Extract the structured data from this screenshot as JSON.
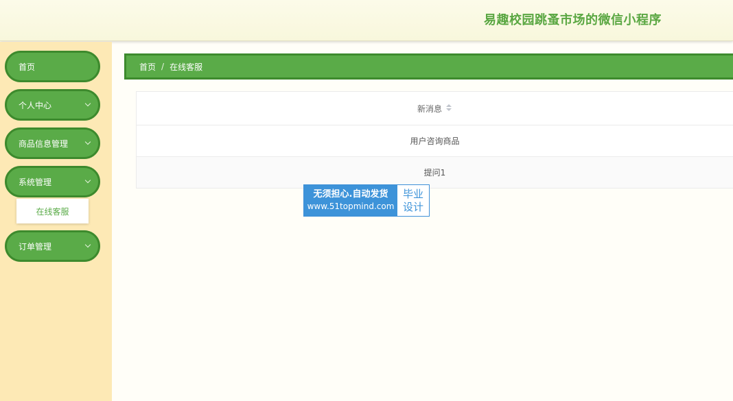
{
  "header": {
    "title": "易趣校园跳蚤市场的微信小程序"
  },
  "sidebar": {
    "items": [
      {
        "label": "首页",
        "has_children": false
      },
      {
        "label": "个人中心",
        "has_children": true
      },
      {
        "label": "商品信息管理",
        "has_children": true
      },
      {
        "label": "系统管理",
        "has_children": true,
        "expanded": true,
        "children": [
          {
            "label": "在线客服",
            "active": true
          }
        ]
      },
      {
        "label": "订单管理",
        "has_children": true
      }
    ]
  },
  "breadcrumb": {
    "home": "首页",
    "separator": "/",
    "current": "在线客服"
  },
  "table": {
    "column": "新消息",
    "rows": [
      "用户咨询商品",
      "提问1"
    ]
  },
  "watermark": {
    "line1": "无须担心.自动发货",
    "line2": "www.51topmind.com",
    "badge_line1": "毕业",
    "badge_line2": "设计"
  },
  "colors": {
    "accent": "#5aab48",
    "accent_border": "#3d8a2d",
    "sidebar_bg": "#fde9b5",
    "title": "#5aa742",
    "watermark_blue": "#3d93d9"
  }
}
